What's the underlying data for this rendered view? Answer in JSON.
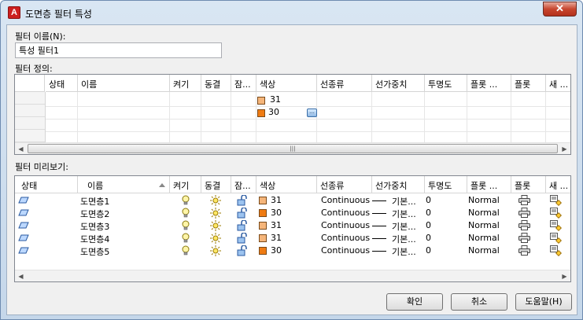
{
  "window": {
    "title": "도면층 필터 특성",
    "app_icon_letter": "A",
    "close_label": "✕"
  },
  "filter_name": {
    "label": "필터 이름(N):",
    "value": "특성 필터1"
  },
  "definition": {
    "label": "필터 정의:",
    "columns": [
      "상태",
      "이름",
      "켜기",
      "동결",
      "잠...",
      "색상",
      "선종류",
      "선가중치",
      "투명도",
      "플롯 ...",
      "플롯",
      "새 ..."
    ],
    "color_values": [
      "31",
      "30"
    ],
    "colors": {
      "c31": "#f5b57a",
      "c30": "#ef7b12"
    }
  },
  "preview": {
    "label": "필터 미리보기:",
    "columns": [
      "상태",
      "이름",
      "켜기",
      "동결",
      "잠...",
      "색상",
      "선종류",
      "선가중치",
      "투명도",
      "플롯 ...",
      "플롯",
      "새 ..."
    ],
    "rows": [
      {
        "status_icon": "layer-status-icon",
        "name": "도면층1",
        "on_icon": "lightbulb-on-icon",
        "freeze_icon": "sun-thawed-icon",
        "lock_icon": "padlock-unlocked-icon",
        "color": "31",
        "linetype": "Continuous",
        "lineweight": "기본...",
        "transparency": "0",
        "plot_style": "Normal",
        "plot_icon": "printer-icon",
        "newvp_icon": "new-viewport-freeze-icon"
      },
      {
        "status_icon": "layer-status-icon",
        "name": "도면층2",
        "on_icon": "lightbulb-on-icon",
        "freeze_icon": "sun-thawed-icon",
        "lock_icon": "padlock-unlocked-icon",
        "color": "30",
        "linetype": "Continuous",
        "lineweight": "기본...",
        "transparency": "0",
        "plot_style": "Normal",
        "plot_icon": "printer-icon",
        "newvp_icon": "new-viewport-freeze-icon"
      },
      {
        "status_icon": "layer-status-icon",
        "name": "도면층3",
        "on_icon": "lightbulb-on-icon",
        "freeze_icon": "sun-thawed-icon",
        "lock_icon": "padlock-unlocked-icon",
        "color": "31",
        "linetype": "Continuous",
        "lineweight": "기본...",
        "transparency": "0",
        "plot_style": "Normal",
        "plot_icon": "printer-icon",
        "newvp_icon": "new-viewport-freeze-icon"
      },
      {
        "status_icon": "layer-status-icon",
        "name": "도면층4",
        "on_icon": "lightbulb-on-icon",
        "freeze_icon": "sun-thawed-icon",
        "lock_icon": "padlock-unlocked-icon",
        "color": "31",
        "linetype": "Continuous",
        "lineweight": "기본...",
        "transparency": "0",
        "plot_style": "Normal",
        "plot_icon": "printer-icon",
        "newvp_icon": "new-viewport-freeze-icon"
      },
      {
        "status_icon": "layer-status-icon",
        "name": "도면층5",
        "on_icon": "lightbulb-on-icon",
        "freeze_icon": "sun-thawed-icon",
        "lock_icon": "padlock-unlocked-icon",
        "color": "30",
        "linetype": "Continuous",
        "lineweight": "기본...",
        "transparency": "0",
        "plot_style": "Normal",
        "plot_icon": "printer-icon",
        "newvp_icon": "new-viewport-freeze-icon"
      }
    ]
  },
  "buttons": {
    "ok": "확인",
    "cancel": "취소",
    "help": "도움말(H)"
  },
  "scroll": {
    "left_arrow": "◀",
    "right_arrow": "▶",
    "grip": "|||"
  }
}
